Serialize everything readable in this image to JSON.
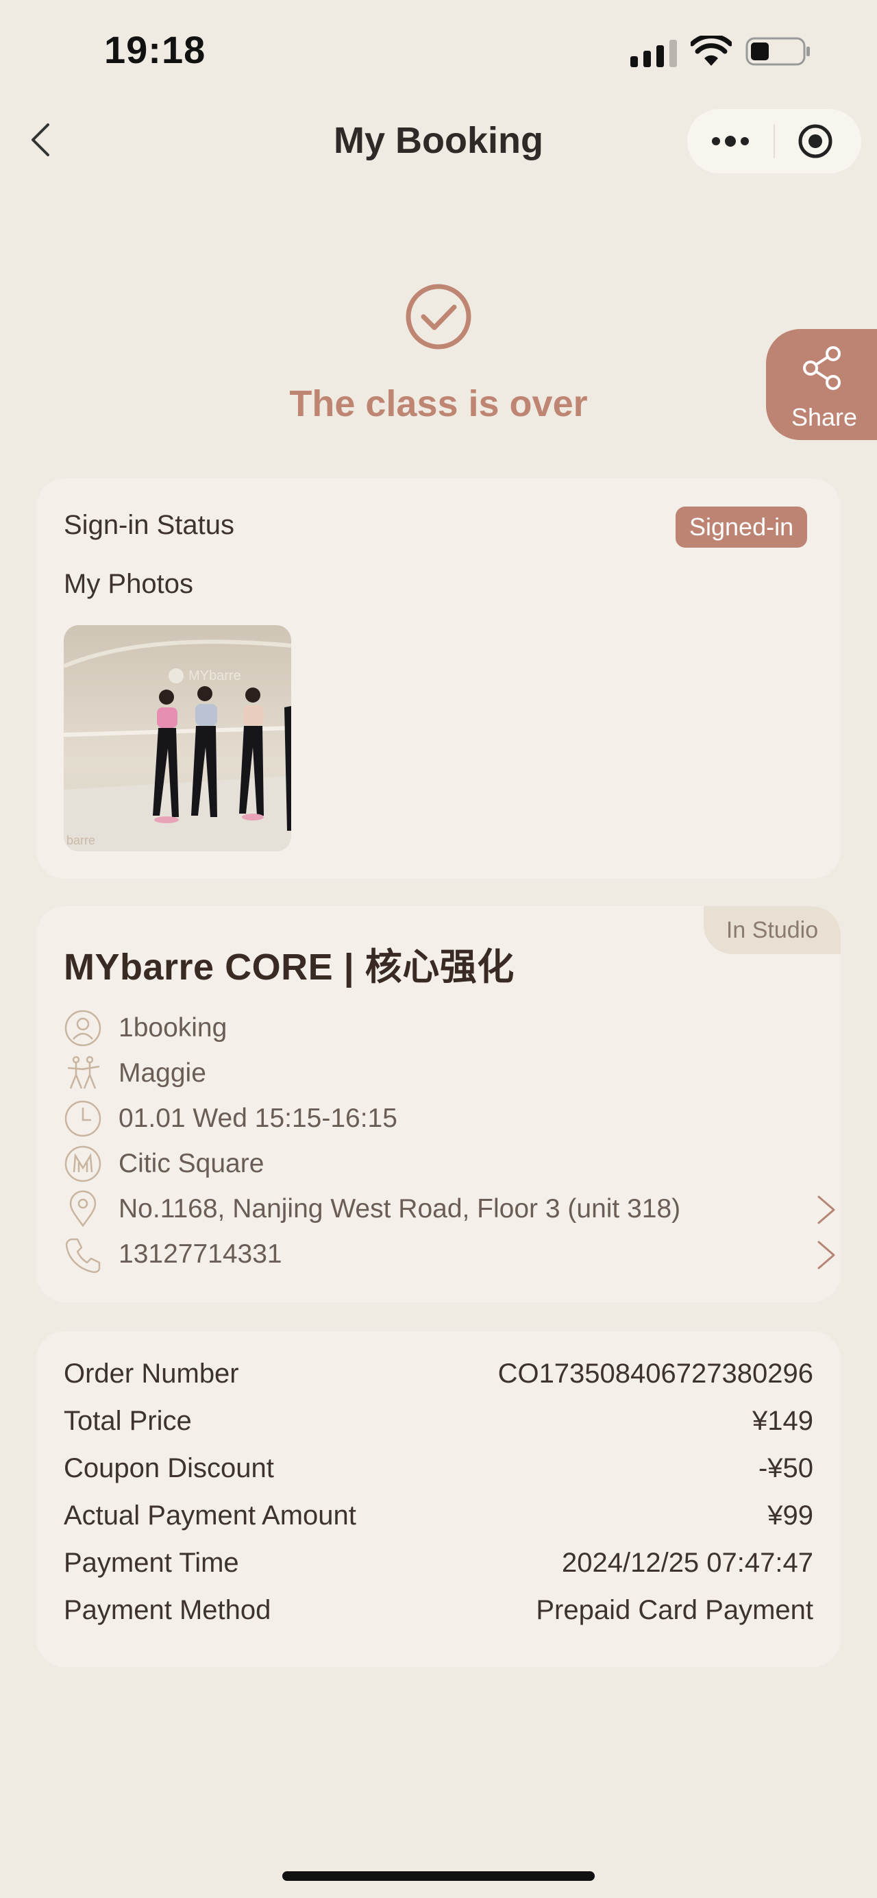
{
  "status_bar": {
    "time": "19:18"
  },
  "nav": {
    "title": "My Booking"
  },
  "hero": {
    "title": "The class is over"
  },
  "share": {
    "label": "Share"
  },
  "signin": {
    "label": "Sign-in Status",
    "badge": "Signed-in",
    "photos_label": "My Photos",
    "photo_logo": "MYbarre",
    "photo_watermark": "barre"
  },
  "class_info": {
    "mode_tag": "In Studio",
    "title": "MYbarre CORE | 核心强化",
    "rows": [
      {
        "icon": "user-icon",
        "text": "1booking"
      },
      {
        "icon": "dancers-icon",
        "text": "Maggie"
      },
      {
        "icon": "clock-icon",
        "text": "01.01 Wed 15:15-16:15"
      },
      {
        "icon": "studio-logo-icon",
        "text": "Citic Square"
      },
      {
        "icon": "location-pin-icon",
        "text": "No.1168, Nanjing West Road, Floor 3 (unit 318)"
      },
      {
        "icon": "phone-icon",
        "text": "13127714331"
      }
    ]
  },
  "order": {
    "rows": [
      {
        "label": "Order Number",
        "value": "CO1735084067273802​96"
      },
      {
        "label": "Total Price",
        "value": "¥149"
      },
      {
        "label": "Coupon Discount",
        "value": "-¥50"
      },
      {
        "label": "Actual Payment Amount",
        "value": "¥99"
      },
      {
        "label": "Payment Time",
        "value": "2024/12/25 07:47:47"
      },
      {
        "label": "Payment Method",
        "value": "Prepaid Card Payment"
      }
    ]
  },
  "colors": {
    "background": "#efebe2",
    "card": "#f4f0e9",
    "accent": "#bd8474",
    "hero_text": "#be8572",
    "tag_bg": "#e8e1d3"
  }
}
